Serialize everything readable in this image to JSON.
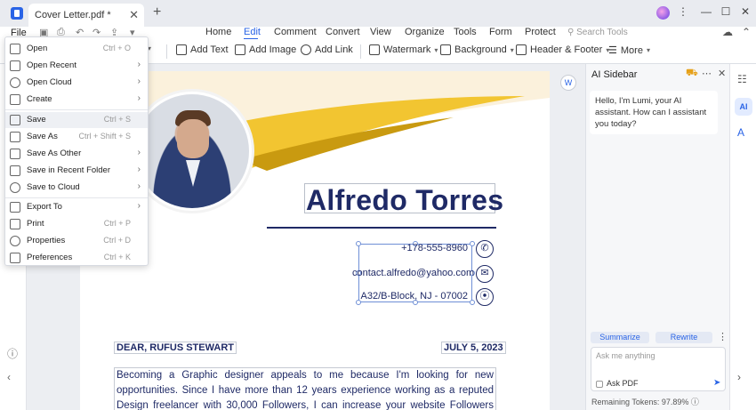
{
  "app": {
    "tab_title": "Cover Letter.pdf *",
    "file_menu_label": "File",
    "search_tools_placeholder": "Search Tools"
  },
  "ribbon_tabs": [
    "Home",
    "Edit",
    "Comment",
    "Convert",
    "View",
    "Organize",
    "Tools",
    "Form",
    "Protect"
  ],
  "active_ribbon_tab": "Edit",
  "toolbar": {
    "add_text": "Add Text",
    "add_image": "Add Image",
    "add_link": "Add Link",
    "watermark": "Watermark",
    "background": "Background",
    "header_footer": "Header & Footer",
    "more": "More"
  },
  "file_menu": {
    "items": [
      {
        "label": "Open",
        "shortcut": "Ctrl + O",
        "submenu": false
      },
      {
        "label": "Open Recent",
        "shortcut": "",
        "submenu": true
      },
      {
        "label": "Open Cloud",
        "shortcut": "",
        "submenu": true
      },
      {
        "label": "Create",
        "shortcut": "",
        "submenu": true
      },
      {
        "label": "Save",
        "shortcut": "Ctrl + S",
        "submenu": false
      },
      {
        "label": "Save As",
        "shortcut": "Ctrl + Shift + S",
        "submenu": false
      },
      {
        "label": "Save As Other",
        "shortcut": "",
        "submenu": true
      },
      {
        "label": "Save in Recent Folder",
        "shortcut": "",
        "submenu": true
      },
      {
        "label": "Save to Cloud",
        "shortcut": "",
        "submenu": true
      },
      {
        "label": "Export To",
        "shortcut": "",
        "submenu": true
      },
      {
        "label": "Print",
        "shortcut": "Ctrl + P",
        "submenu": false
      },
      {
        "label": "Properties",
        "shortcut": "Ctrl + D",
        "submenu": false
      },
      {
        "label": "Preferences",
        "shortcut": "Ctrl + K",
        "submenu": false
      }
    ],
    "hovered_item": "Save"
  },
  "document": {
    "name": "Alfredo Torres",
    "phone": "+178-555-8960",
    "email": "contact.alfredo@yahoo.com",
    "address": "A32/B-Block, NJ - 07002",
    "salutation": "DEAR, RUFUS STEWART",
    "date": "JULY 5, 2023",
    "body": "Becoming a Graphic designer appeals to me because I'm looking for new opportunities. Since I have more than 12 years experience working as a reputed Design freelancer with 30,000 Followers, I can increase your website Followers count."
  },
  "ai_sidebar": {
    "title": "AI Sidebar",
    "greeting": "Hello, I'm Lumi, your AI assistant. How can I assistant you today?",
    "summarize_label": "Summarize",
    "rewrite_label": "Rewrite",
    "input_placeholder": "Ask me anything",
    "ask_pdf_label": "Ask PDF",
    "tokens": "Remaining Tokens: 97.89%"
  },
  "colors": {
    "accent": "#2a64e6",
    "doc_navy": "#1f2a66",
    "swoosh_yellow": "#f2c531",
    "swoosh_dark": "#c99a10"
  }
}
